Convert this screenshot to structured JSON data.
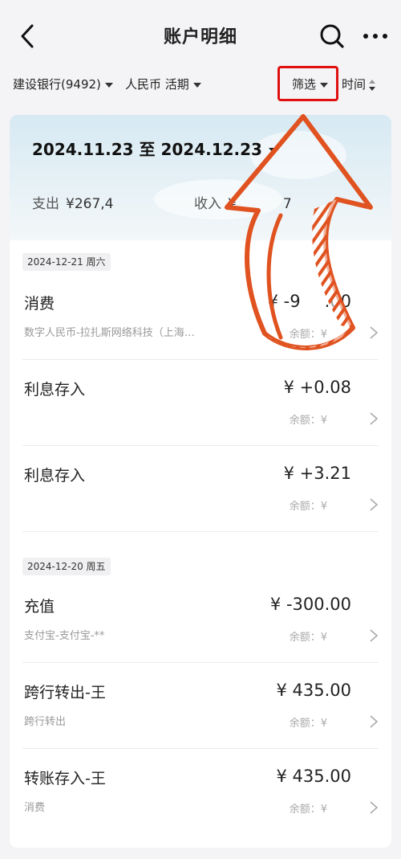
{
  "header": {
    "title": "账户明细",
    "back_icon": "chevron-left-icon",
    "search_icon": "search-icon",
    "more_icon": "more-dots-icon"
  },
  "filters": {
    "bank": "建设银行(9492)",
    "currency": "人民币 活期",
    "filter_label": "筛选",
    "time_label": "时间"
  },
  "summary": {
    "period": "2024.11.23 至 2024.12.23",
    "expense_label": "支出",
    "expense_value": "¥267,4",
    "income_label": "收入",
    "income_value": "¥",
    "income_value_tail": "7"
  },
  "groups": [
    {
      "date": "2024-12-21 周六",
      "items": [
        {
          "title": "消费",
          "subtitle": "数字人民币-拉扎斯网络科技（上海…",
          "amount": "¥ -9",
          "amount_tail": ".00",
          "balance": "余额：¥"
        },
        {
          "title": "利息存入",
          "subtitle": "",
          "amount": "¥ +0.08",
          "amount_tail": "",
          "balance": "余额：¥"
        },
        {
          "title": "利息存入",
          "subtitle": "",
          "amount": "¥ +3.21",
          "amount_tail": "",
          "balance": "余额：¥"
        }
      ]
    },
    {
      "date": "2024-12-20 周五",
      "items": [
        {
          "title": "充值",
          "subtitle": "支付宝-支付宝-**",
          "amount": "¥ -300.00",
          "amount_tail": "",
          "balance": "余额：¥"
        },
        {
          "title": "跨行转出-王",
          "subtitle": "跨行转出",
          "amount": "¥ 435.00",
          "amount_tail": "",
          "balance": "余额：¥"
        },
        {
          "title": "转账存入-王",
          "subtitle": "消费",
          "amount": "¥ 435.00",
          "amount_tail": "",
          "balance": "余额：¥"
        }
      ]
    }
  ],
  "colors": {
    "highlight_box": "#e01010",
    "annotation_arrow": "#e0521f"
  }
}
